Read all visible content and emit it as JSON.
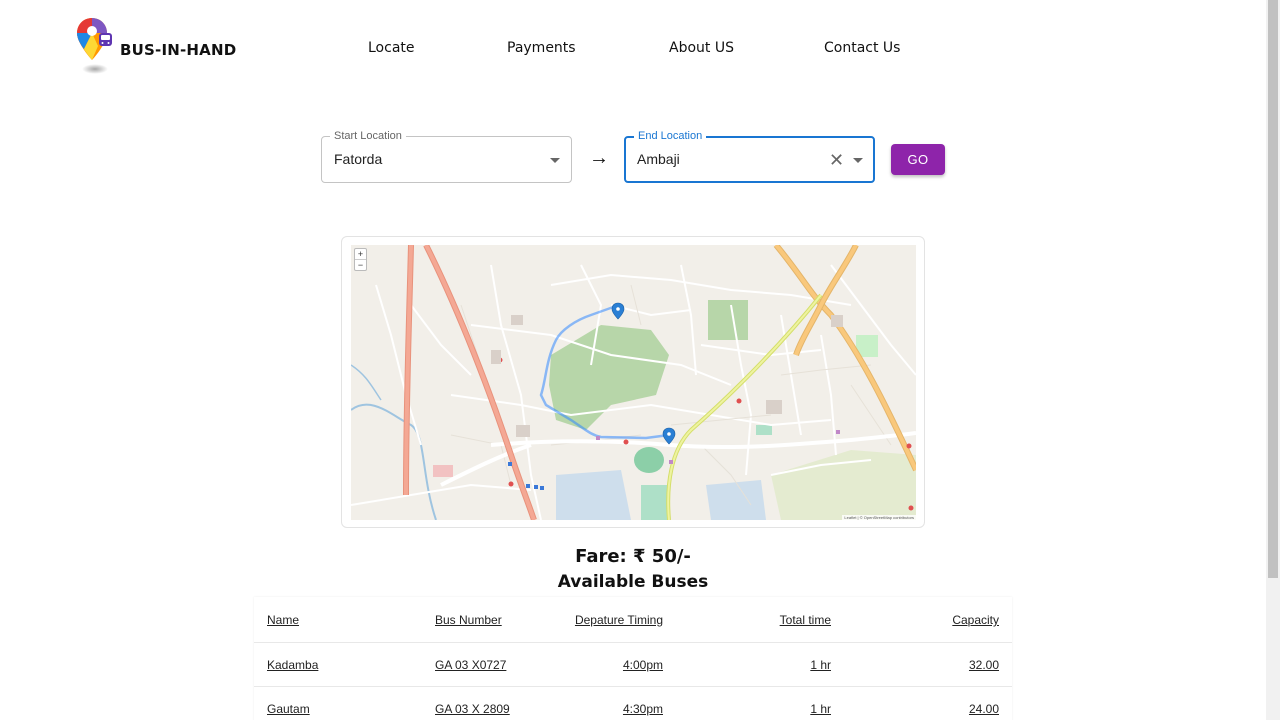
{
  "header": {
    "brand": "BUS-IN-HAND",
    "nav": [
      "Locate",
      "Payments",
      "About US",
      "Contact Us"
    ]
  },
  "search": {
    "start_label": "Start Location",
    "start_value": "Fatorda",
    "end_label": "End Location",
    "end_value": "Ambaji",
    "arrow": "→",
    "go_label": "GO"
  },
  "map": {
    "zoom_in": "+",
    "zoom_out": "−",
    "attribution": "Leaflet | © OpenStreetMap contributors"
  },
  "fare": "Fare: ₹ 50/-",
  "available_heading": "Available Buses",
  "table": {
    "headers": [
      "Name",
      "Bus Number",
      "Depature Timing",
      "Total time",
      "Capacity"
    ],
    "rows": [
      [
        "Kadamba",
        "GA 03 X0727",
        "4:00pm",
        "1 hr",
        "32.00"
      ],
      [
        "Gautam",
        "GA 03 X 2809",
        "4:30pm",
        "1 hr",
        "24.00"
      ]
    ]
  },
  "colors": {
    "accent": "#8e24aa",
    "focus": "#1976d2"
  }
}
